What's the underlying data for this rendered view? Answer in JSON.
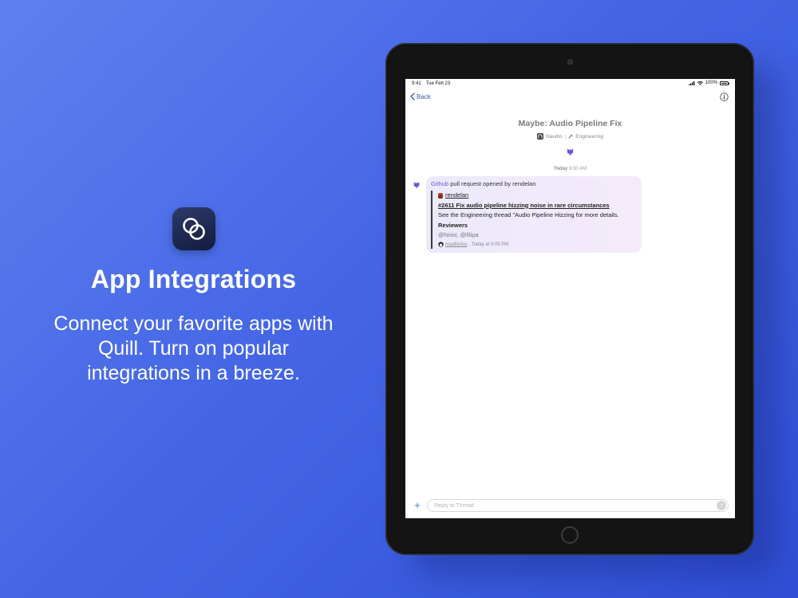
{
  "promo": {
    "title": "App Integrations",
    "subtitle": "Connect your favorite apps with Quill. Turn on popular integrations in a breeze.",
    "icon": "quill-logo-icon"
  },
  "status_bar": {
    "time": "9:41",
    "date": "Tue Feb 23",
    "battery": "100%"
  },
  "nav": {
    "back_label": "Back"
  },
  "thread": {
    "title": "Maybe: Audio Pipeline Fix",
    "org": "Naudio",
    "channel": "Engineering"
  },
  "divider": {
    "day": "Today",
    "time": "9:30 AM"
  },
  "message": {
    "source": "Github",
    "text": "pull request opened by rendelan",
    "embed": {
      "author": "rendelan",
      "link": "#2611 Fix audio pipeline hizzing noise in rare circumstances",
      "description": "See the Engineering thread \"Audio Pipeline Hizzing for more details.",
      "reviewers_label": "Reviewers",
      "reviewers": "@hirini, @filipa",
      "repo": "naudio/ios",
      "timestamp": ", Today at 4:05 PM"
    }
  },
  "composer": {
    "placeholder": "Reply to Thread",
    "plus": "+",
    "send": "↑"
  },
  "colors": {
    "background_start": "#5f80ee",
    "background_end": "#2f4fd6",
    "accent": "#6c57d9",
    "link_blue": "#3c5aa8"
  }
}
